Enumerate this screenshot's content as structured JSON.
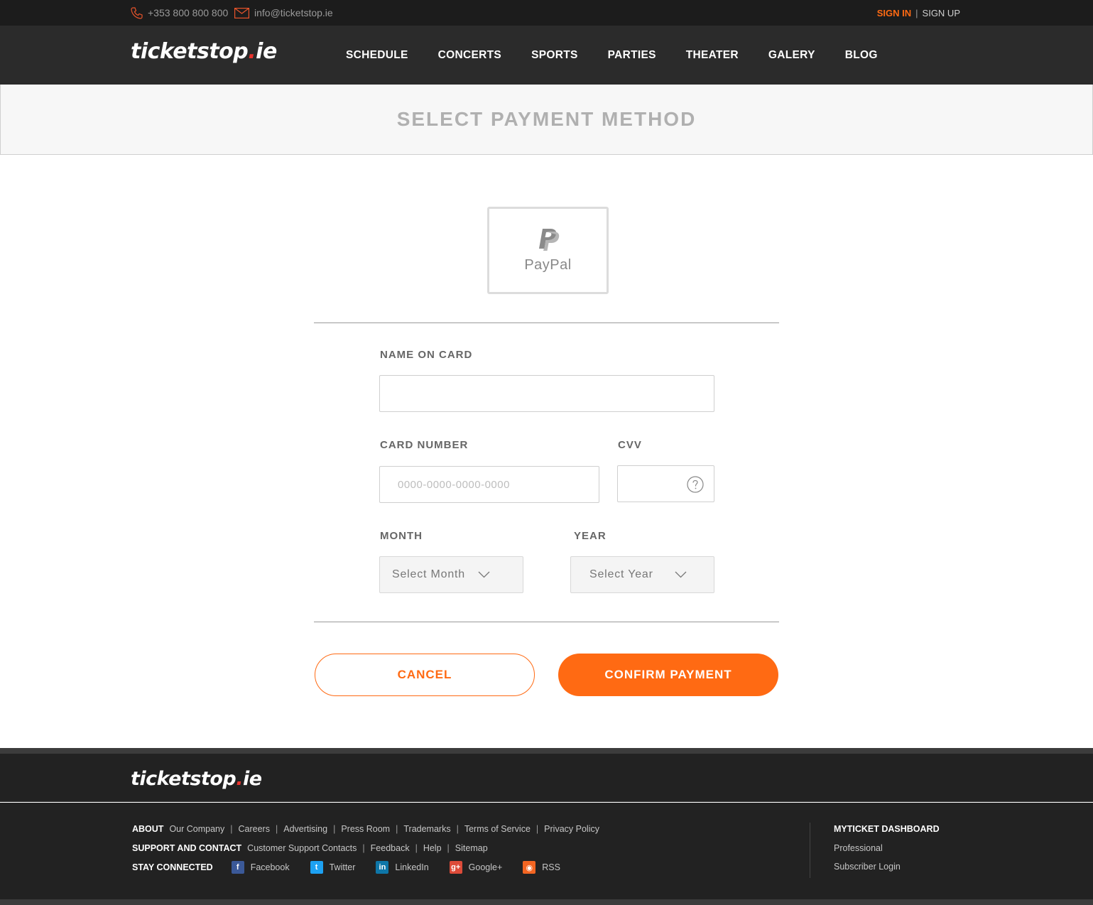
{
  "topbar": {
    "phone": "+353 800 800 800",
    "email": "info@ticketstop.ie",
    "sign_in": "SIGN IN",
    "separator": "|",
    "sign_up": "SIGN UP"
  },
  "brand": {
    "name": "ticketstop",
    "dot": ".",
    "tld": "ie"
  },
  "nav": [
    "SCHEDULE",
    "CONCERTS",
    "SPORTS",
    "PARTIES",
    "THEATER",
    "GALERY",
    "BLOG"
  ],
  "page_title": "SELECT PAYMENT METHOD",
  "payment_method": {
    "label": "PayPal",
    "icon": "paypal-icon"
  },
  "form": {
    "name_label": "NAME ON CARD",
    "name_value": "",
    "card_label": "CARD NUMBER",
    "card_placeholder": "0000-0000-0000-0000",
    "cvv_label": "CVV",
    "cvv_help_icon": "question-icon",
    "month_label": "MONTH",
    "month_value": "Select Month",
    "year_label": "YEAR",
    "year_value": "Select Year"
  },
  "buttons": {
    "cancel": "CANCEL",
    "confirm": "CONFIRM PAYMENT"
  },
  "colors": {
    "accent": "#ff6a13",
    "dark": "#2b2b2b",
    "topbar": "#1c1c1c"
  },
  "footer": {
    "about": {
      "heading": "ABOUT",
      "links": [
        "Our Company",
        "Careers",
        "Advertising",
        "Press Room",
        "Trademarks",
        "Terms of Service",
        "Privacy Policy"
      ]
    },
    "support": {
      "heading": "SUPPORT AND CONTACT",
      "links": [
        "Customer Support Contacts",
        "Feedback",
        "Help",
        "Sitemap"
      ]
    },
    "stay_connected": {
      "heading": "STAY CONNECTED",
      "links": [
        "Facebook",
        "Twitter",
        "LinkedIn",
        "Google+",
        "RSS"
      ]
    },
    "dashboard": {
      "heading": "MYTICKET DASHBOARD",
      "links": [
        "Professional",
        "Subscriber Login"
      ]
    }
  }
}
